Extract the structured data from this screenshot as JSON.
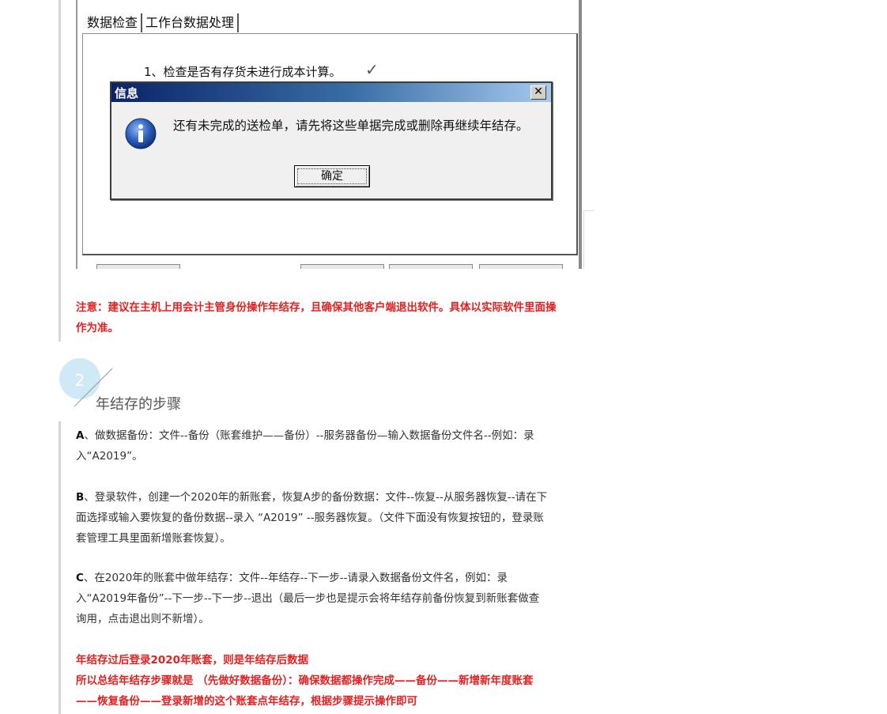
{
  "screenshot": {
    "tabs": [
      "数据检查",
      "工作台数据处理"
    ],
    "check_item": "1、检查是否有存货未进行成本计算。",
    "checkmark_icon": "checkmark-icon",
    "dialog": {
      "title": "信息",
      "close_label": "✕",
      "icon": "info-icon",
      "message": "还有未完成的送检单，请先将这些单据完成或删除再继续年结存。",
      "ok_label": "确定"
    }
  },
  "note": {
    "line1": "注意：建议在主机上用会计主管身份操作年结存，且确保其他客户端退出软件。具体以实际软件里面操",
    "line2": "作为准。"
  },
  "section": {
    "number": "2",
    "title": "年结存的步骤"
  },
  "steps": {
    "a": {
      "letter": "A",
      "line1": "、做数据备份：文件--备份（账套维护——备份）--服务器备份—输入数据备份文件名--例如：录",
      "line2": "入“A2019”。"
    },
    "b": {
      "letter": "B",
      "line1": "、登录软件，创建一个2020年的新账套，恢复A步的备份数据：文件--恢复--从服务器恢复--请在下",
      "line2": "面选择或输入要恢复的备份数据--录入 “A2019” --服务器恢复。（文件下面没有恢复按钮的，登录账",
      "line3": "套管理工具里面新增账套恢复）。"
    },
    "c": {
      "letter": "C",
      "line1": "、在2020年的账套中做年结存：文件--年结存--下一步--请录入数据备份文件名，例如：录",
      "line2": "入“A2019年备份”--下一步--下一步--退出（最后一步也是提示会将年结存前备份恢复到新账套做查",
      "line3": "询用，点击退出则不新增）。"
    }
  },
  "summary": {
    "line1": "年结存过后登录2020年账套，则是年结存后数据",
    "line2": "所以总结年结存步骤就是 （先做好数据备份）：确保数据都操作完成——备份——新增新年度账套",
    "line3": "——恢复备份——登录新增的这个账套点年结存，根据步骤提示操作即可"
  }
}
